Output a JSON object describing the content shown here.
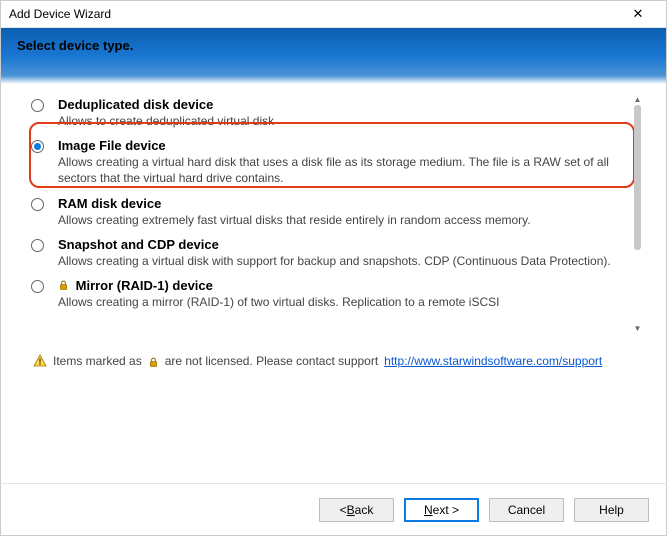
{
  "window": {
    "title": "Add Device Wizard",
    "close_label": "✕"
  },
  "banner": {
    "title": "Select device type."
  },
  "options": [
    {
      "title": "Deduplicated disk device",
      "desc": "Allows to create deduplicated virtual disk",
      "selected": false,
      "locked": false
    },
    {
      "title": "Image File device",
      "desc": "Allows creating a virtual hard disk that uses a disk file as its storage medium. The file is a RAW set of all sectors that the virtual hard drive contains.",
      "selected": true,
      "locked": false
    },
    {
      "title": "RAM disk device",
      "desc": "Allows creating extremely fast virtual disks that reside entirely in random access memory.",
      "selected": false,
      "locked": false
    },
    {
      "title": "Snapshot and CDP device",
      "desc": "Allows creating a virtual disk with support for backup and snapshots. CDP (Continuous Data Protection).",
      "selected": false,
      "locked": false
    },
    {
      "title": "Mirror (RAID-1) device",
      "desc": "Allows creating a mirror (RAID-1) of two virtual disks. Replication to a remote iSCSI",
      "selected": false,
      "locked": true
    }
  ],
  "notice": {
    "prefix": "Items marked as",
    "suffix": "are not licensed. Please contact support",
    "link_text": "http://www.starwindsoftware.com/support"
  },
  "buttons": {
    "back_prefix": "< ",
    "back_accel": "B",
    "back_rest": "ack",
    "next_accel": "N",
    "next_rest": "ext >",
    "cancel": "Cancel",
    "help": "Help"
  }
}
